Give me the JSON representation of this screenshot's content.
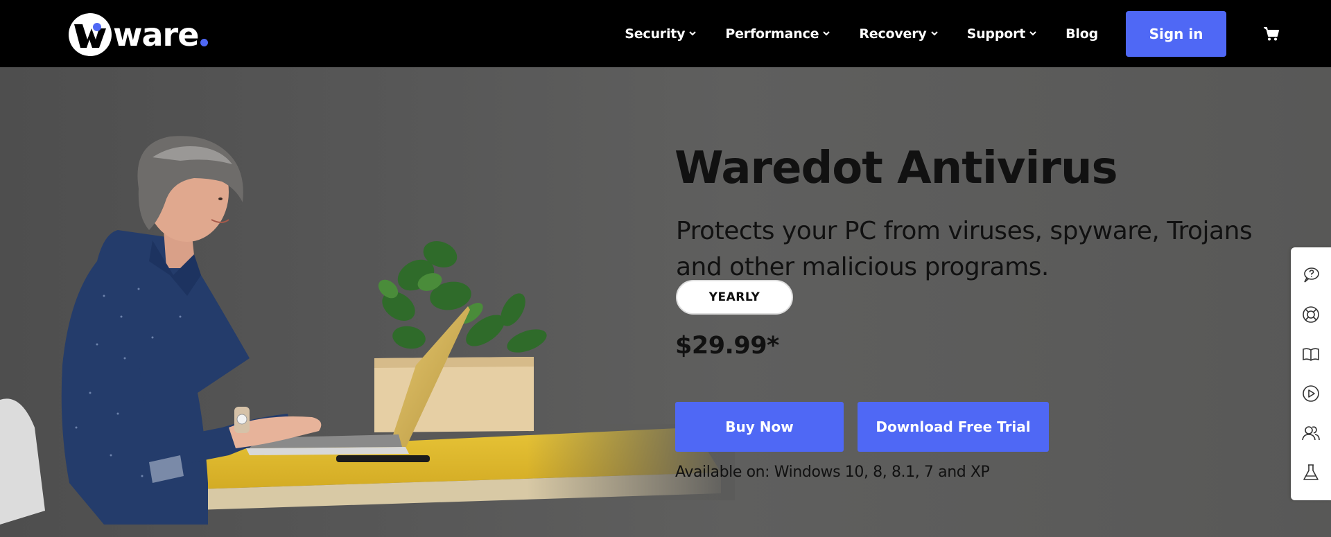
{
  "brand": {
    "logo_text": "ware",
    "accent": "#4f68f5"
  },
  "nav": {
    "items": [
      {
        "label": "Security",
        "has_dropdown": true
      },
      {
        "label": "Performance",
        "has_dropdown": true
      },
      {
        "label": "Recovery",
        "has_dropdown": true
      },
      {
        "label": "Support",
        "has_dropdown": true
      },
      {
        "label": "Blog",
        "has_dropdown": false
      }
    ],
    "signin_label": "Sign in",
    "cart_icon": "cart-icon"
  },
  "hero": {
    "title": "Waredot Antivirus",
    "subtitle": "Protects your PC from viruses, spyware, Trojans and other malicious programs.",
    "plan_label": "YEARLY",
    "price": "$29.99*",
    "buy_label": "Buy Now",
    "trial_label": "Download Free Trial",
    "availability": "Available on: Windows 10, 8, 8.1, 7 and XP"
  },
  "sidebar": {
    "icons": [
      "chat-help-icon",
      "lifebuoy-icon",
      "book-icon",
      "play-icon",
      "users-icon",
      "flask-icon"
    ]
  }
}
